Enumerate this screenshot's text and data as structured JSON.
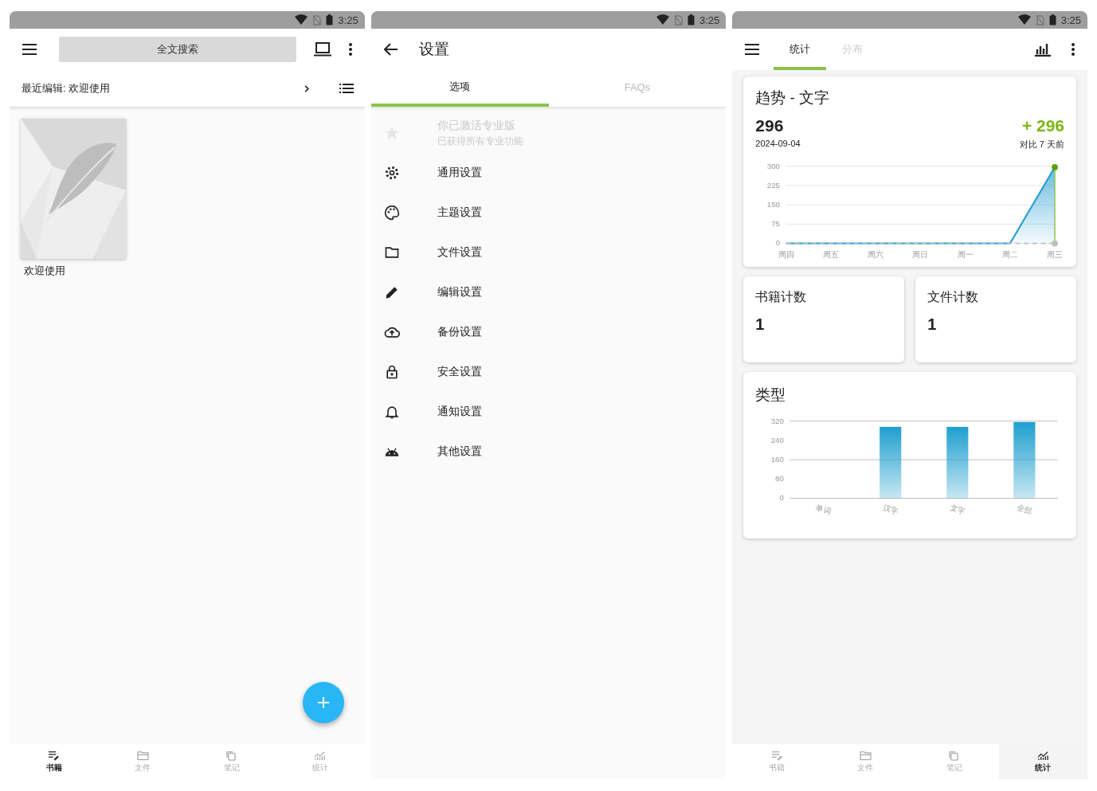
{
  "screens": [
    {
      "kind": "library",
      "status_time": "3:25",
      "search_button": "全文搜索",
      "recent": "最近编辑: 欢迎使用",
      "books": [
        {
          "title": "欢迎使用"
        }
      ],
      "nav": [
        {
          "label": "书籍",
          "selected": true
        },
        {
          "label": "文件",
          "selected": false
        },
        {
          "label": "笔记",
          "selected": false
        },
        {
          "label": "统计",
          "selected": false
        }
      ]
    },
    {
      "kind": "settings",
      "status_time": "3:25",
      "title": "设置",
      "tabs": [
        {
          "label": "选项",
          "selected": true
        },
        {
          "label": "FAQs",
          "selected": false
        }
      ],
      "pro": {
        "title": "你已激活专业版",
        "subtitle": "已获得所有专业功能",
        "disabled": true
      },
      "items": [
        "通用设置",
        "主题设置",
        "文件设置",
        "编辑设置",
        "备份设置",
        "安全设置",
        "通知设置",
        "其他设置"
      ]
    },
    {
      "kind": "stats",
      "status_time": "3:25",
      "tabs": [
        {
          "label": "统计",
          "selected": true
        },
        {
          "label": "分布",
          "selected": false
        }
      ],
      "trend": {
        "title": "趋势 - 文字",
        "value": "296",
        "date": "2024-09-04",
        "change": "+ 296",
        "change_note": "对比 7 天前",
        "chart_data": {
          "type": "area",
          "grid": true,
          "categories": [
            "周四",
            "周五",
            "周六",
            "周日",
            "周一",
            "周二",
            "周三"
          ],
          "ylim": [
            0,
            300
          ],
          "yticks": [
            0,
            75,
            150,
            225,
            300
          ],
          "series": [
            {
              "color": "#2a9fd0",
              "line_style": "solid",
              "values": [
                0,
                0,
                0,
                0,
                0,
                0,
                296
              ]
            }
          ],
          "ref_lines": [
            {
              "axis": "y",
              "value": 0,
              "color": "#bdbdbd",
              "line_style": "dashed"
            }
          ]
        }
      },
      "counts": [
        {
          "label": "书籍计数",
          "value": "1"
        },
        {
          "label": "文件计数",
          "value": "1"
        }
      ],
      "types": {
        "title": "类型",
        "chart_data": {
          "type": "bar",
          "grid": true,
          "categories": [
            "单词",
            "汉字",
            "文字",
            "全部"
          ],
          "ylim": [
            0,
            320
          ],
          "yticks": [
            0,
            80,
            160,
            240,
            320
          ],
          "series": [
            {
              "color": "#1e9fcf",
              "values": [
                0,
                296,
                296,
                316
              ]
            }
          ]
        }
      },
      "nav": [
        {
          "label": "书籍",
          "selected": false
        },
        {
          "label": "文件",
          "selected": false
        },
        {
          "label": "笔记",
          "selected": false
        },
        {
          "label": "统计",
          "selected": true
        }
      ]
    }
  ]
}
